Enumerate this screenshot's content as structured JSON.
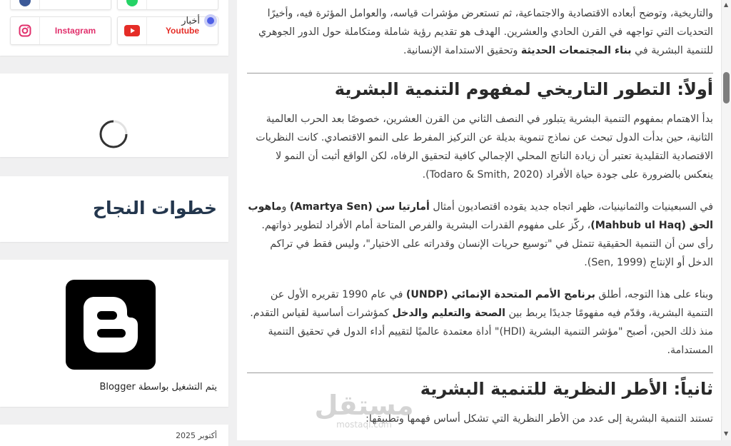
{
  "colors": {
    "accent": "#4e5fe6",
    "heading_blue": "#23364d",
    "instagram": "#e1306c",
    "youtube": "#e52d27"
  },
  "sidebar": {
    "social": {
      "instagram_label": "Instagram",
      "youtube_label": "Youtube",
      "icons": [
        "facebook-icon",
        "whatsapp-icon",
        "instagram-icon",
        "youtube-icon"
      ]
    },
    "news": {
      "label": "أخبار"
    },
    "steps": {
      "title": "خطوات النجاح"
    },
    "blogger": {
      "powered_by": "يتم التشغيل بواسطة Blogger"
    },
    "bottom": {
      "text": "أكتوبر 2025"
    }
  },
  "article": {
    "intro": [
      "والتاريخية، وتوضح أبعاده الاقتصادية والاجتماعية، ثم تستعرض مؤشرات قياسه، والعوامل المؤثرة فيه، وأخيرًا التحديات التي تواجهه في القرن الحادي والعشرين. الهدف هو تقديم رؤية شاملة ومتكاملة حول الدور الجوهري للتنمية البشرية في ",
      "بناء المجتمعات الحديثة",
      " وتحقيق الاستدامة الإنسانية."
    ],
    "heading1": "أولاً: التطور التاريخي لمفهوم التنمية البشرية",
    "p1": "بدأ الاهتمام بمفهوم التنمية البشرية يتبلور في النصف الثاني من القرن العشرين، خصوصًا بعد الحرب العالمية الثانية، حين بدأت الدول تبحث عن نماذج تنموية بديلة عن التركيز المفرط على النمو الاقتصادي. كانت النظريات الاقتصادية التقليدية تعتبر أن زيادة الناتج المحلي الإجمالي كافية لتحقيق الرفاه، لكن الواقع أثبت أن النمو لا ينعكس بالضرورة على جودة حياة الأفراد (Todaro & Smith, 2020).",
    "p2": [
      "في السبعينيات والثمانينيات، ظهر اتجاه جديد يقوده اقتصاديون أمثال ",
      "أمارتيا سن (Amartya Sen)",
      " و",
      "ماهوب الحق (Mahbub ul Haq)",
      "، ركّز على مفهوم القدرات البشرية والفرص المتاحة أمام الأفراد لتطوير ذواتهم. رأى سن أن التنمية الحقيقية تتمثل في \"توسيع حريات الإنسان وقدراته على الاختيار\"، وليس فقط في تراكم الدخل أو الإنتاج (Sen, 1999)."
    ],
    "p3": [
      "وبناء على هذا التوجه، أطلق ",
      "برنامج الأمم المتحدة الإنمائي (UNDP)",
      " في عام 1990 تقريره الأول عن التنمية البشرية، وقدّم فيه مفهومًا جديدًا يربط بين ",
      "الصحة والتعليم والدخل",
      " كمؤشرات أساسية لقياس التقدم. منذ ذلك الحين، أصبح \"مؤشر التنمية البشرية (HDI)\" أداة معتمدة عالميًا لتقييم أداء الدول في تحقيق التنمية المستدامة."
    ],
    "heading2": "ثانياً: الأطر النظرية للتنمية البشرية",
    "p4": "تستند التنمية البشرية إلى عدد من الأطر النظرية التي تشكل أساس فهمها وتطبيقها:"
  },
  "watermark": {
    "brand_ar": "مستقل",
    "brand_en": "mostaql.com"
  }
}
